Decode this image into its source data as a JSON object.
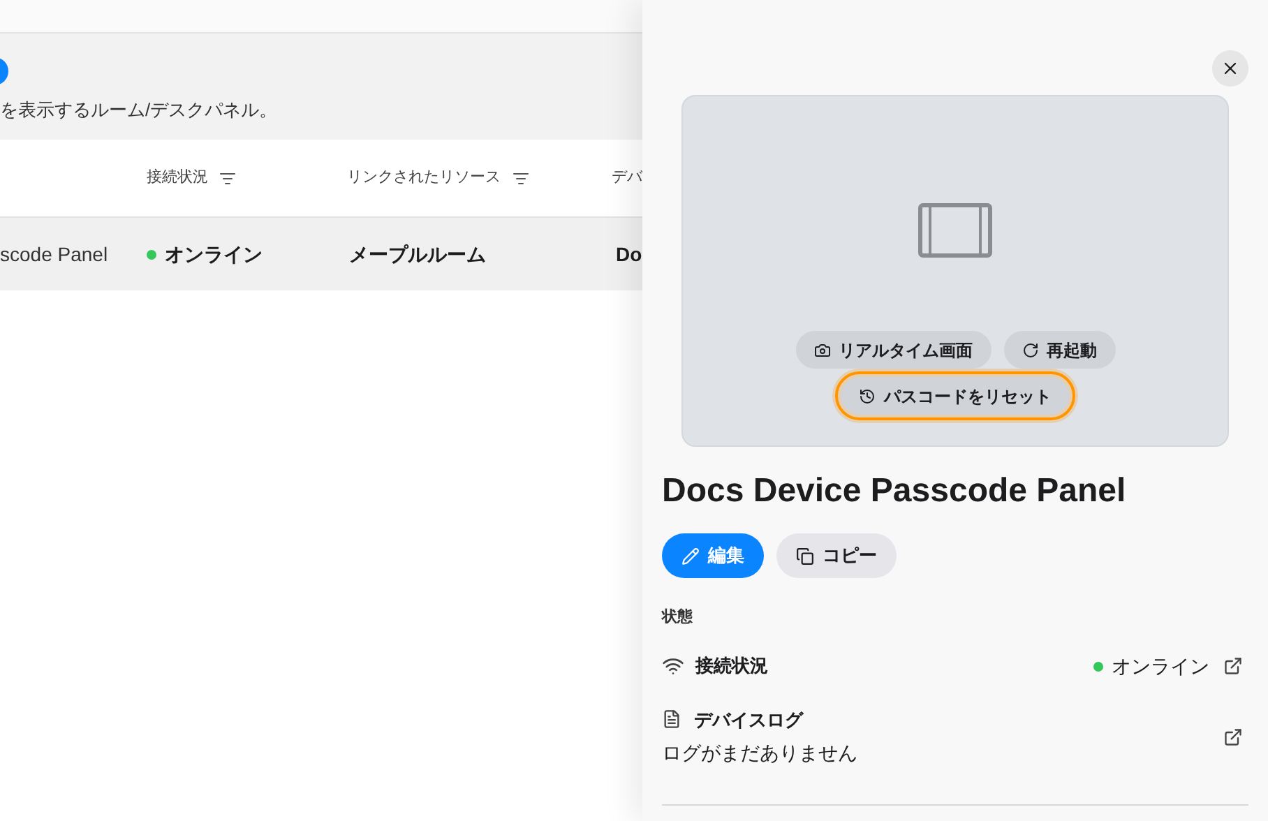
{
  "page": {
    "description": "を表示するルーム/デスクパネル。"
  },
  "table": {
    "columns": [
      {
        "label": "接続状況",
        "filter": true
      },
      {
        "label": "リンクされたリソース",
        "filter": true
      },
      {
        "label": "デバ",
        "filter": false
      }
    ],
    "rows": [
      {
        "name": "scode Panel",
        "status": "オンライン",
        "color": "#34c759",
        "resource": "メープルルーム",
        "column_4": "Do",
        "selected": true
      }
    ]
  },
  "panel": {
    "preview_actions": [
      {
        "label": "リアルタイム画面",
        "kind": "camera",
        "focused": false
      },
      {
        "label": "再起動",
        "kind": "restart",
        "focused": false
      },
      {
        "label": "パスコードをリセット",
        "kind": "reset",
        "focused": true
      }
    ],
    "title": "Docs Device Passcode Panel",
    "actions": [
      {
        "label": "編集",
        "kind": "edit",
        "primary": true
      },
      {
        "label": "コピー",
        "kind": "copy",
        "primary": false
      }
    ],
    "section": "状態",
    "items": [
      {
        "kind": "connection",
        "label": "接続状況",
        "value": "オンライン",
        "color": "#34c759"
      },
      {
        "kind": "log",
        "label": "デバイスログ",
        "detail": "ログがまだありません"
      }
    ]
  }
}
